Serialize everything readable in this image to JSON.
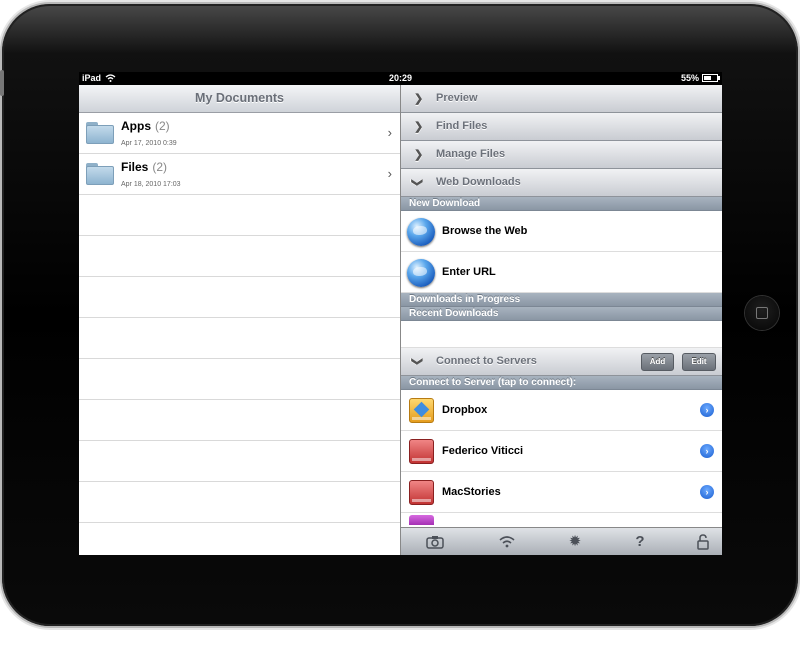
{
  "status": {
    "device": "iPad",
    "time": "20:29",
    "battery": "55%",
    "battery_level": 0.55
  },
  "left": {
    "title": "My Documents",
    "folders": [
      {
        "name": "Apps",
        "count": "(2)",
        "date": "Apr 17, 2010 0:39"
      },
      {
        "name": "Files",
        "count": "(2)",
        "date": "Apr 18, 2010 17:03"
      }
    ]
  },
  "right": {
    "sections": {
      "preview": "Preview",
      "find": "Find Files",
      "manage": "Manage Files",
      "web": "Web Downloads",
      "connect": "Connect to Servers"
    },
    "new_download": {
      "header": "New Download",
      "browse": "Browse the Web",
      "enter_url": "Enter URL"
    },
    "in_progress": "Downloads in Progress",
    "recent": "Recent Downloads",
    "buttons": {
      "add": "Add",
      "edit": "Edit"
    },
    "servers_header": "Connect to Server (tap to connect):",
    "servers": [
      "Dropbox",
      "Federico Viticci",
      "MacStories"
    ]
  },
  "colors": {
    "group_bar": "#8a96a4",
    "header_text": "#6a6f78",
    "disclosure": "#1c5fd0"
  }
}
